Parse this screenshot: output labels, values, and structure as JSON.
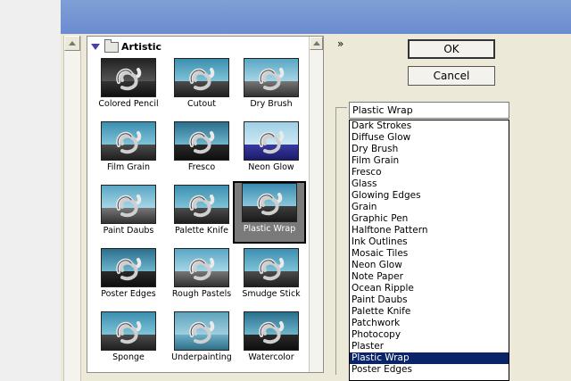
{
  "category": {
    "label": "Artistic"
  },
  "thumbnails": [
    {
      "label": "Colored Pencil",
      "style": "pencil"
    },
    {
      "label": "Cutout",
      "style": "normal"
    },
    {
      "label": "Dry Brush",
      "style": "light"
    },
    {
      "label": "Film Grain",
      "style": "normal"
    },
    {
      "label": "Fresco",
      "style": "dark"
    },
    {
      "label": "Neon Glow",
      "style": "neon"
    },
    {
      "label": "Paint Daubs",
      "style": "light"
    },
    {
      "label": "Palette Knife",
      "style": "normal"
    },
    {
      "label": "Plastic Wrap",
      "style": "selected"
    },
    {
      "label": "Poster Edges",
      "style": "dark"
    },
    {
      "label": "Rough Pastels",
      "style": "light"
    },
    {
      "label": "Smudge Stick",
      "style": "normal"
    },
    {
      "label": "Sponge",
      "style": "normal"
    },
    {
      "label": "Underpainting",
      "style": "water"
    },
    {
      "label": "Watercolor",
      "style": "dark"
    }
  ],
  "selected_thumbnail": "Plastic Wrap",
  "buttons": {
    "ok": "OK",
    "cancel": "Cancel"
  },
  "collapse_glyph": "»",
  "filter_select": {
    "value": "Plastic Wrap"
  },
  "filter_list": [
    "Dark Strokes",
    "Diffuse Glow",
    "Dry Brush",
    "Film Grain",
    "Fresco",
    "Glass",
    "Glowing Edges",
    "Grain",
    "Graphic Pen",
    "Halftone Pattern",
    "Ink Outlines",
    "Mosaic Tiles",
    "Neon Glow",
    "Note Paper",
    "Ocean Ripple",
    "Paint Daubs",
    "Palette Knife",
    "Patchwork",
    "Photocopy",
    "Plaster",
    "Plastic Wrap",
    "Poster Edges"
  ],
  "selected_filter": "Plastic Wrap",
  "colors": {
    "list_highlight": "#0a246a",
    "titlebar": "#6b8ccf",
    "dialog_bg": "#ece9d8"
  },
  "icons": [
    "disclosure-triangle-icon",
    "folder-icon",
    "scroll-up-arrow-icon",
    "collapse-chevron-icon"
  ]
}
